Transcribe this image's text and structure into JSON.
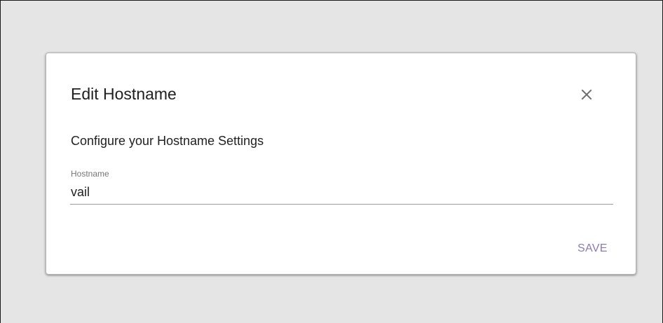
{
  "dialog": {
    "title": "Edit Hostname",
    "close_icon": "close-icon",
    "subtitle": "Configure your Hostname Settings",
    "hostname_field": {
      "label": "Hostname",
      "value": "vail"
    },
    "save_label": "SAVE"
  },
  "colors": {
    "backdrop": "#e5e5e5",
    "dialog_background": "#ffffff",
    "text": "#212121",
    "label": "#757575",
    "accent": "#8c7ab8"
  }
}
